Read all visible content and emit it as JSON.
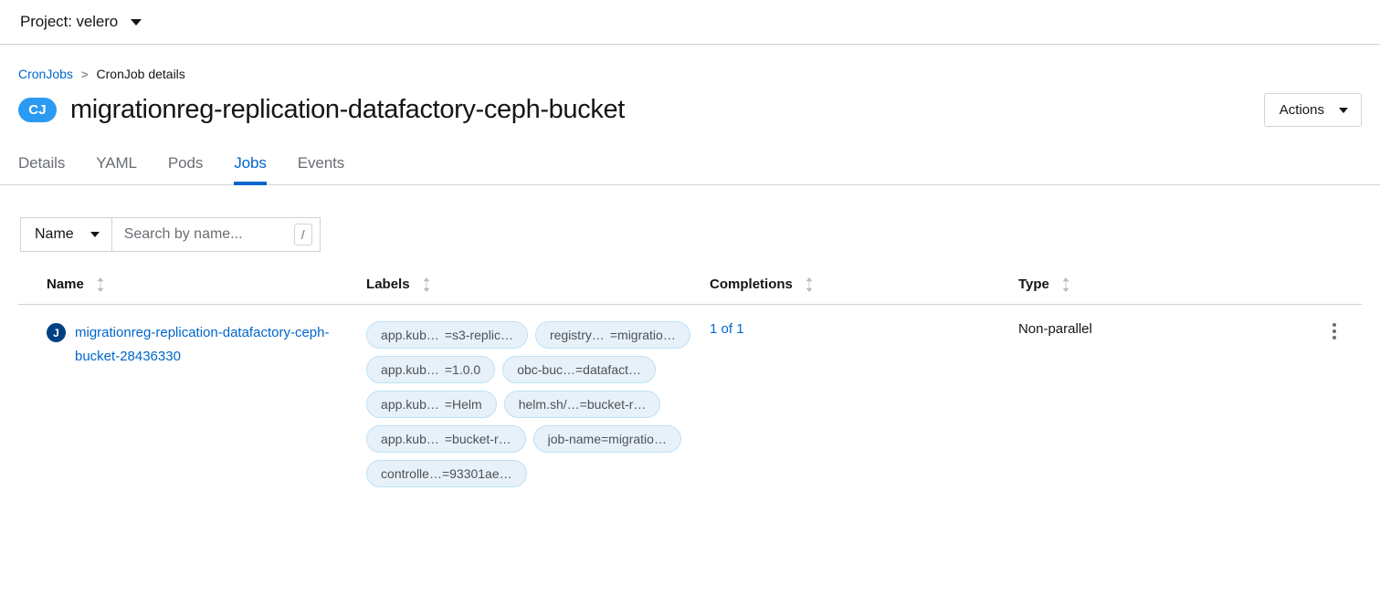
{
  "project_bar": {
    "label": "Project: velero",
    "caret_icon": "chevron-down-icon"
  },
  "breadcrumb": {
    "parent": "CronJobs",
    "separator": ">",
    "current": "CronJob details"
  },
  "header": {
    "badge": "CJ",
    "title": "migrationreg-replication-datafactory-ceph-bucket",
    "actions_label": "Actions",
    "badge_color": "#2b9af3"
  },
  "tabs": [
    {
      "label": "Details",
      "active": false
    },
    {
      "label": "YAML",
      "active": false
    },
    {
      "label": "Pods",
      "active": false
    },
    {
      "label": "Jobs",
      "active": true
    },
    {
      "label": "Events",
      "active": false
    }
  ],
  "toolbar": {
    "filter_label": "Name",
    "search_placeholder": "Search by name...",
    "search_value": "",
    "kbd_shortcut": "/"
  },
  "table": {
    "columns": [
      {
        "label": "Name"
      },
      {
        "label": "Labels"
      },
      {
        "label": "Completions"
      },
      {
        "label": "Type"
      }
    ],
    "rows": [
      {
        "badge": "J",
        "badge_color": "#004080",
        "name": "migrationreg-replication-datafactory-ceph-bucket-28436330",
        "labels": [
          {
            "key": "app.kub…",
            "value": "=s3-replic…"
          },
          {
            "key": "registry…",
            "value": "=migratio…"
          },
          {
            "key": "app.kub…",
            "value": "=1.0.0"
          },
          {
            "key": "obc-buc…",
            "value": "=datafact…"
          },
          {
            "key": "app.kub…",
            "value": "=Helm"
          },
          {
            "key": "helm.sh/…",
            "value": "=bucket-r…"
          },
          {
            "key": "app.kub…",
            "value": "=bucket-r…"
          },
          {
            "key": "job-name",
            "value": "=migratio…"
          },
          {
            "key": "controlle…",
            "value": "=93301ae…"
          }
        ],
        "completions": "1 of 1",
        "type": "Non-parallel"
      }
    ]
  }
}
